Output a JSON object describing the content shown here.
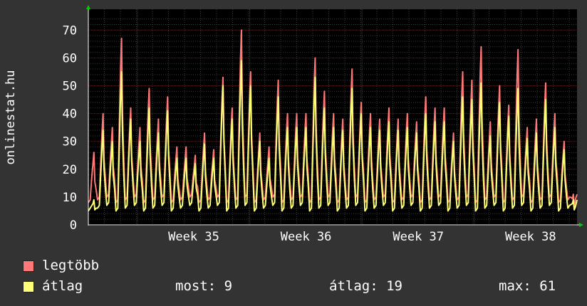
{
  "chart_data": {
    "type": "line",
    "ylabel": "onlinestat.hu",
    "ylim": [
      0,
      75
    ],
    "yticks": [
      0,
      10,
      20,
      30,
      40,
      50,
      60,
      70
    ],
    "xlim": [
      "Week 34",
      "Week 38+"
    ],
    "xticks": [
      {
        "label": "Week 35",
        "week": 1
      },
      {
        "label": "Week 36",
        "week": 2
      },
      {
        "label": "Week 37",
        "week": 3
      },
      {
        "label": "Week 38",
        "week": 4
      }
    ],
    "grid": true,
    "background": "#000000",
    "series": [
      {
        "name": "legtöbb",
        "color": "#ff7777",
        "peaks": [
          26,
          40,
          35,
          67,
          42,
          35,
          49,
          38,
          46,
          28,
          28,
          25,
          33,
          27,
          53,
          42,
          70,
          55,
          33,
          28,
          52,
          40,
          40,
          40,
          60,
          48,
          40,
          38,
          56,
          44,
          40,
          38,
          42,
          38,
          40,
          37,
          46,
          42,
          42,
          33,
          55,
          52,
          64,
          37,
          50,
          43,
          63,
          35,
          38,
          51,
          40,
          30,
          11
        ]
      },
      {
        "name": "átlag",
        "color": "#ffff77",
        "peaks": [
          9,
          34,
          30,
          55,
          38,
          30,
          42,
          33,
          41,
          24,
          24,
          22,
          29,
          24,
          50,
          38,
          59,
          50,
          30,
          24,
          46,
          35,
          35,
          35,
          53,
          42,
          35,
          34,
          49,
          40,
          35,
          34,
          37,
          34,
          35,
          33,
          40,
          37,
          37,
          30,
          46,
          45,
          51,
          32,
          44,
          39,
          49,
          31,
          33,
          45,
          35,
          27,
          9
        ]
      }
    ]
  },
  "legend": {
    "max_label": "legtöbb",
    "avg_label": "átlag",
    "now": "most: 9",
    "avg": "átlag: 19",
    "max": "max: 61"
  }
}
